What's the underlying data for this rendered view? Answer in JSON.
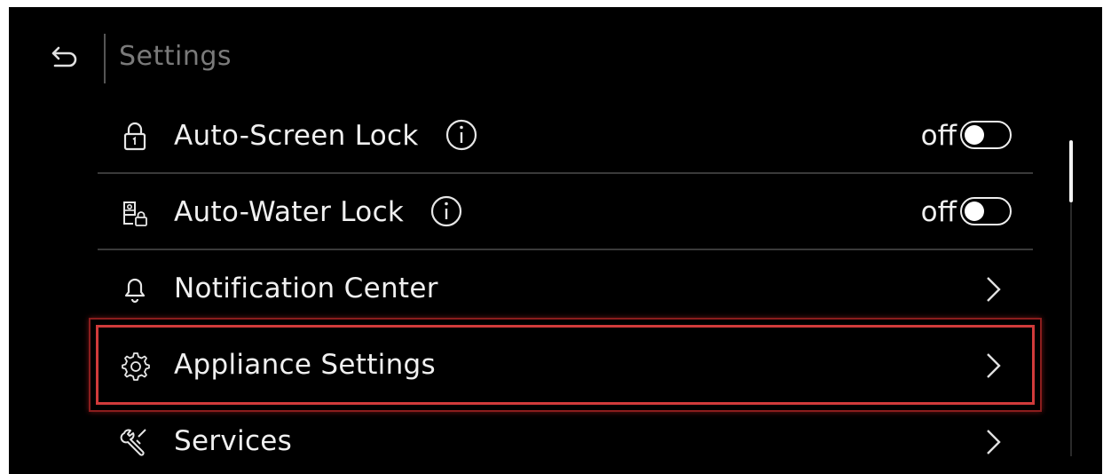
{
  "header": {
    "title": "Settings",
    "back_icon": "back-arrow-icon"
  },
  "rows": [
    {
      "label": "Auto-Screen Lock",
      "icon": "lock-icon",
      "info": true,
      "status": "off",
      "toggle_on": false
    },
    {
      "label": "Auto-Water Lock",
      "icon": "water-lock-icon",
      "info": true,
      "status": "off",
      "toggle_on": false
    },
    {
      "label": "Notification Center",
      "icon": "bell-icon"
    },
    {
      "label": "Appliance Settings",
      "icon": "gear-icon",
      "selected": true
    },
    {
      "label": "Services",
      "icon": "wrench-icon"
    }
  ],
  "colors": {
    "background": "#000000",
    "text": "#f0f0f0",
    "title": "#7a7a7a",
    "selection": "#d13b3b"
  }
}
